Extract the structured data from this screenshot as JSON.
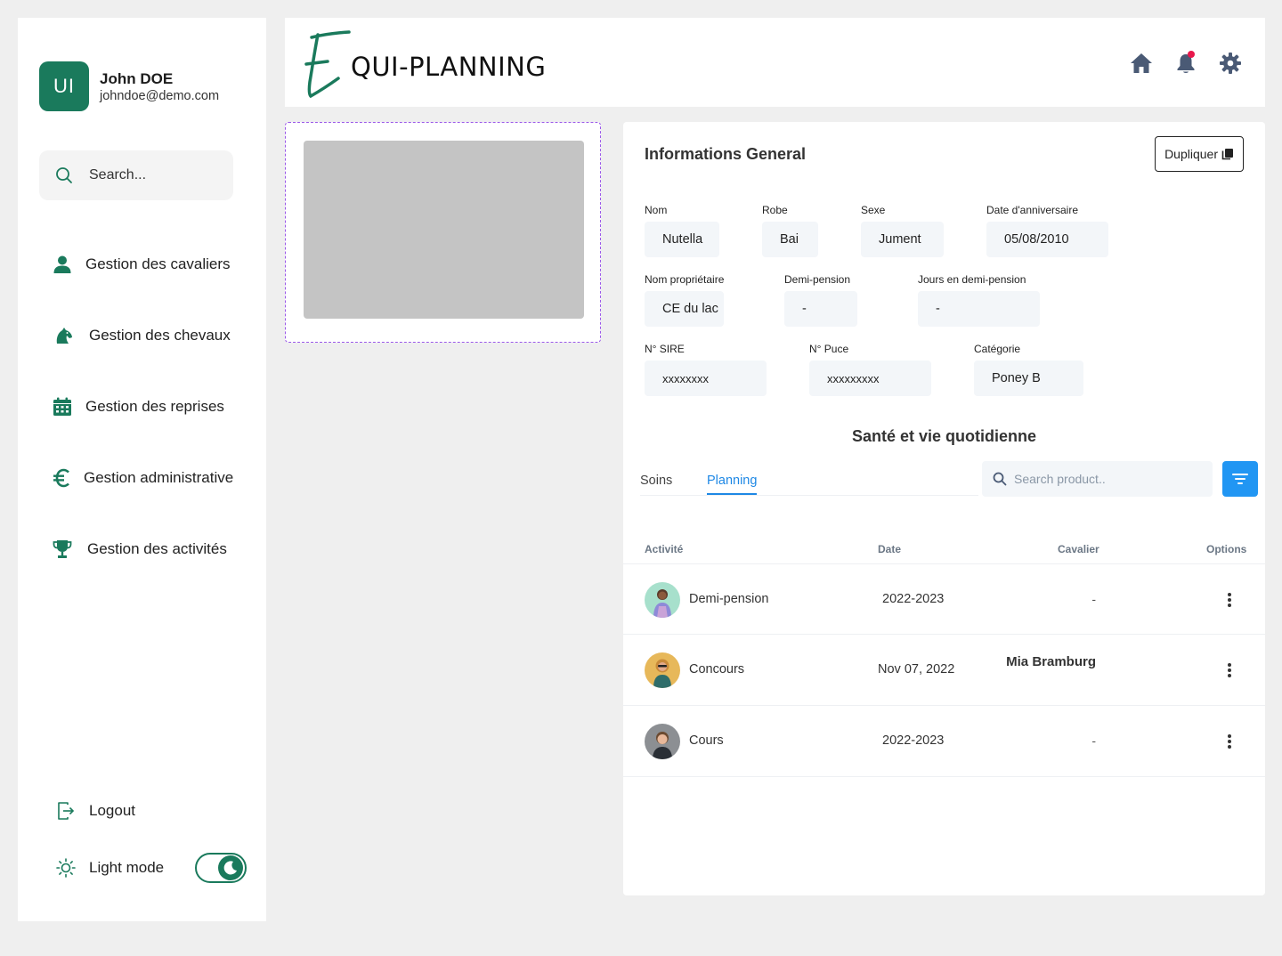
{
  "sidebar": {
    "profile": {
      "initials": "UI",
      "name": "John DOE",
      "email": "johndoe@demo.com"
    },
    "search_placeholder": "Search...",
    "nav": [
      {
        "label": "Gestion des cavaliers",
        "icon": "user-icon"
      },
      {
        "label": "Gestion des chevaux",
        "icon": "horse-icon"
      },
      {
        "label": "Gestion des reprises",
        "icon": "calendar-icon"
      },
      {
        "label": "Gestion administrative",
        "icon": "euro-icon"
      },
      {
        "label": "Gestion des activités",
        "icon": "trophy-icon"
      }
    ],
    "logout_label": "Logout",
    "theme_label": "Light mode"
  },
  "header": {
    "logo_text": "QUI-PLANNING"
  },
  "card": {
    "title": "Informations General",
    "duplicate_label": "Dupliquer",
    "fields": {
      "nom": {
        "label": "Nom",
        "value": "Nutella"
      },
      "robe": {
        "label": "Robe",
        "value": "Bai"
      },
      "sexe": {
        "label": "Sexe",
        "value": "Jument"
      },
      "anniversaire": {
        "label": "Date d'anniversaire",
        "value": "05/08/2010"
      },
      "proprietaire": {
        "label": "Nom propriétaire",
        "value": "CE du lac"
      },
      "demi_pension": {
        "label": "Demi-pension",
        "value": "-"
      },
      "jours": {
        "label": "Jours en demi-pension",
        "value": "-"
      },
      "sire": {
        "label": "N° SIRE",
        "value": "xxxxxxxx"
      },
      "puce": {
        "label": "N° Puce",
        "value": "xxxxxxxxx"
      },
      "categorie": {
        "label": "Catégorie",
        "value": "Poney B"
      }
    },
    "section_title": "Santé et vie quotidienne",
    "tabs": [
      "Soins",
      "Planning"
    ],
    "search_placeholder": "Search product..",
    "table": {
      "headers": [
        "Activité",
        "Date",
        "Cavalier",
        "Options"
      ],
      "rows": [
        {
          "activite": "Demi-pension",
          "date": "2022-2023",
          "cavalier": "-"
        },
        {
          "activite": "Concours",
          "date": "Nov 07, 2022",
          "cavalier": "Mia Bramburg"
        },
        {
          "activite": "Cours",
          "date": "2022-2023",
          "cavalier": "-"
        }
      ]
    }
  },
  "colors": {
    "brand": "#1a7a5c",
    "accent": "#2196f3",
    "notification": "#e8174b"
  }
}
